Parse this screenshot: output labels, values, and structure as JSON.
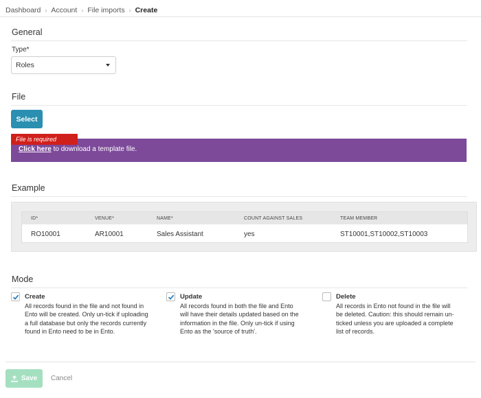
{
  "breadcrumb": [
    "Dashboard",
    "Account",
    "File imports",
    "Create"
  ],
  "general": {
    "title": "General",
    "type_label": "Type*",
    "type_value": "Roles"
  },
  "file": {
    "title": "File",
    "select_label": "Select",
    "error": "File is required",
    "template_link": "Click here",
    "template_text": " to download a template file."
  },
  "example": {
    "title": "Example",
    "headers": [
      "ID*",
      "VENUE*",
      "NAME*",
      "COUNT AGAINST SALES",
      "TEAM MEMBER"
    ],
    "row": [
      "RO10001",
      "AR10001",
      "Sales Assistant",
      "yes",
      "ST10001,ST10002,ST10003"
    ]
  },
  "mode": {
    "title": "Mode",
    "options": [
      {
        "label": "Create",
        "checked": true,
        "lines": [
          "All records found in the file and not found in",
          "Ento will be created. Only un-tick if uploading",
          "a full database but only the records currently",
          "found in Ento need to be in Ento."
        ]
      },
      {
        "label": "Update",
        "checked": true,
        "lines": [
          "All records found in both the file and Ento",
          "will have their details updated based on the",
          "information in the file. Only un-tick if using",
          "Ento as the 'source of truth'."
        ]
      },
      {
        "label": "Delete",
        "checked": false,
        "lines": [
          "All records in Ento not found in the file will",
          "be deleted. Caution: this should remain un-",
          "ticked unless you are uploaded a complete",
          "list of records."
        ]
      }
    ]
  },
  "footer": {
    "save_label": "Save",
    "cancel_label": "Cancel"
  },
  "colors": {
    "accent": "#2a8fb0",
    "banner": "#7d4a9a",
    "error": "#d0201b",
    "save_disabled": "#a4e0c0"
  }
}
